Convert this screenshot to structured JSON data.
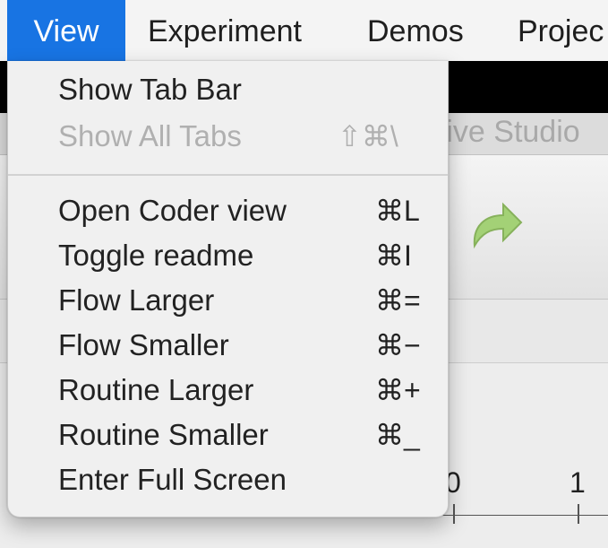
{
  "menubar": {
    "items": [
      {
        "label": "View"
      },
      {
        "label": "Experiment"
      },
      {
        "label": "Demos"
      },
      {
        "label": "Projec"
      }
    ]
  },
  "background": {
    "tab_title": "ative Studio",
    "timeline_ticks": [
      "0",
      "1"
    ]
  },
  "view_menu": {
    "items": [
      {
        "label": "Show Tab Bar",
        "shortcut": "",
        "enabled": true
      },
      {
        "label": "Show All Tabs",
        "shortcut": "⇧⌘\\",
        "enabled": false
      },
      {
        "label": "Open Coder view",
        "shortcut": "⌘L",
        "enabled": true
      },
      {
        "label": "Toggle readme",
        "shortcut": "⌘I",
        "enabled": true
      },
      {
        "label": "Flow Larger",
        "shortcut": "⌘=",
        "enabled": true
      },
      {
        "label": "Flow Smaller",
        "shortcut": "⌘−",
        "enabled": true
      },
      {
        "label": "Routine Larger",
        "shortcut": "⌘+",
        "enabled": true
      },
      {
        "label": "Routine Smaller",
        "shortcut": "⌘_",
        "enabled": true
      },
      {
        "label": "Enter Full Screen",
        "shortcut": "",
        "enabled": true
      }
    ]
  },
  "colors": {
    "accent": "#1874e3",
    "redo_arrow": "#9ccf6a"
  }
}
